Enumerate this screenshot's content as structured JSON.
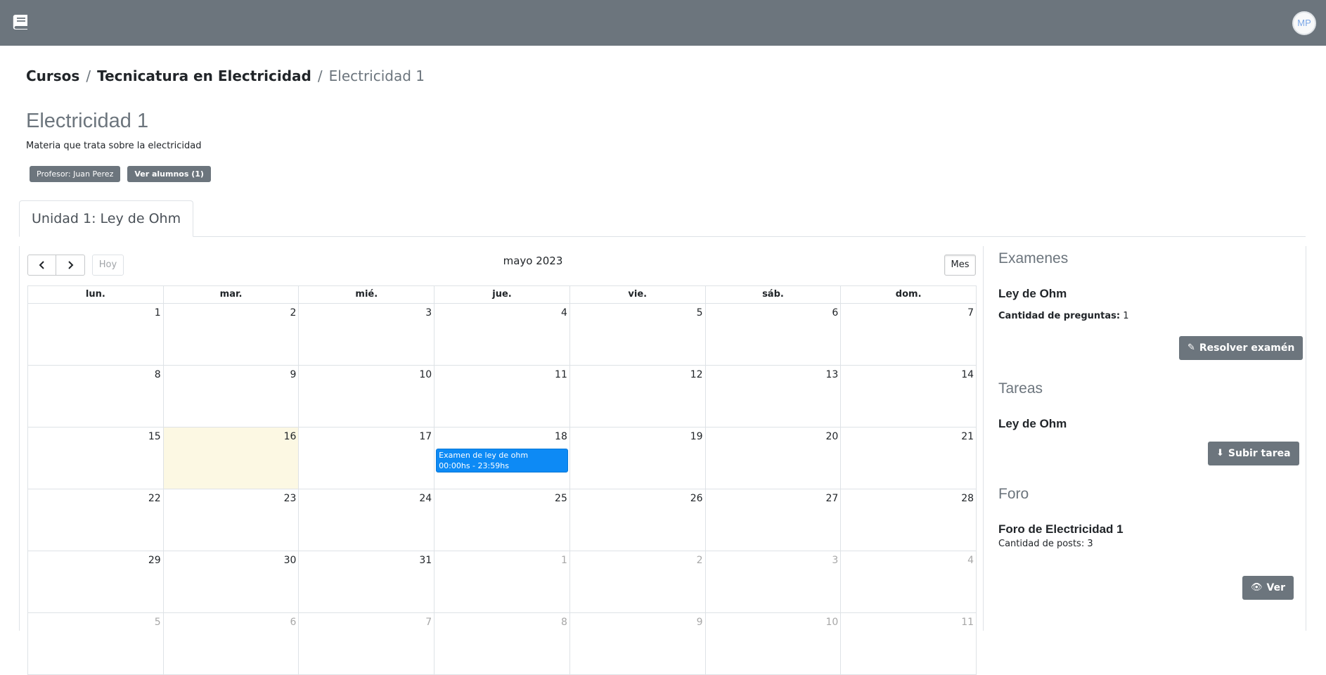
{
  "topbar": {
    "avatar_initials": "MP"
  },
  "breadcrumb": {
    "items": [
      "Cursos",
      "Tecnicatura en Electricidad"
    ],
    "separator": "/",
    "active": "Electricidad 1"
  },
  "course": {
    "title": "Electricidad 1",
    "description": "Materia que trata sobre la electricidad",
    "teacher_badge": "Profesor: Juan Perez",
    "students_badge": "Ver alumnos (1)"
  },
  "tabs": [
    {
      "label": "Unidad 1: Ley de Ohm",
      "active": true
    }
  ],
  "calendar": {
    "title": "mayo 2023",
    "today_label": "Hoy",
    "view_label": "Mes",
    "weekdays": [
      "lun.",
      "mar.",
      "mié.",
      "jue.",
      "vie.",
      "sáb.",
      "dom."
    ],
    "weeks": [
      [
        1,
        2,
        3,
        4,
        5,
        6,
        7
      ],
      [
        8,
        9,
        10,
        11,
        12,
        13,
        14
      ],
      [
        15,
        16,
        17,
        18,
        19,
        20,
        21
      ],
      [
        22,
        23,
        24,
        25,
        26,
        27,
        28
      ],
      [
        29,
        30,
        31,
        1,
        2,
        3,
        4
      ],
      [
        5,
        6,
        7,
        8,
        9,
        10,
        11
      ]
    ],
    "today_day": 16,
    "event": {
      "title": "Examen de ley de ohm",
      "time": "00:00hs - 23:59hs",
      "day": 18,
      "color": "#0d8af5"
    },
    "today_color": "#fcf8e3"
  },
  "sidebar": {
    "exams": {
      "heading": "Examenes",
      "title": "Ley de Ohm",
      "questions_label": "Cantidad de preguntas:",
      "questions_value": "1",
      "button": "Resolver examén"
    },
    "tasks": {
      "heading": "Tareas",
      "title": "Ley de Ohm",
      "button": "Subir tarea"
    },
    "forum": {
      "heading": "Foro",
      "title": "Foro de Electricidad 1",
      "posts": "Cantidad de posts: 3",
      "button": "Ver"
    }
  },
  "colors": {
    "topbar": "#6c757d",
    "button": "#6c757d",
    "event": "#0d8af5"
  }
}
